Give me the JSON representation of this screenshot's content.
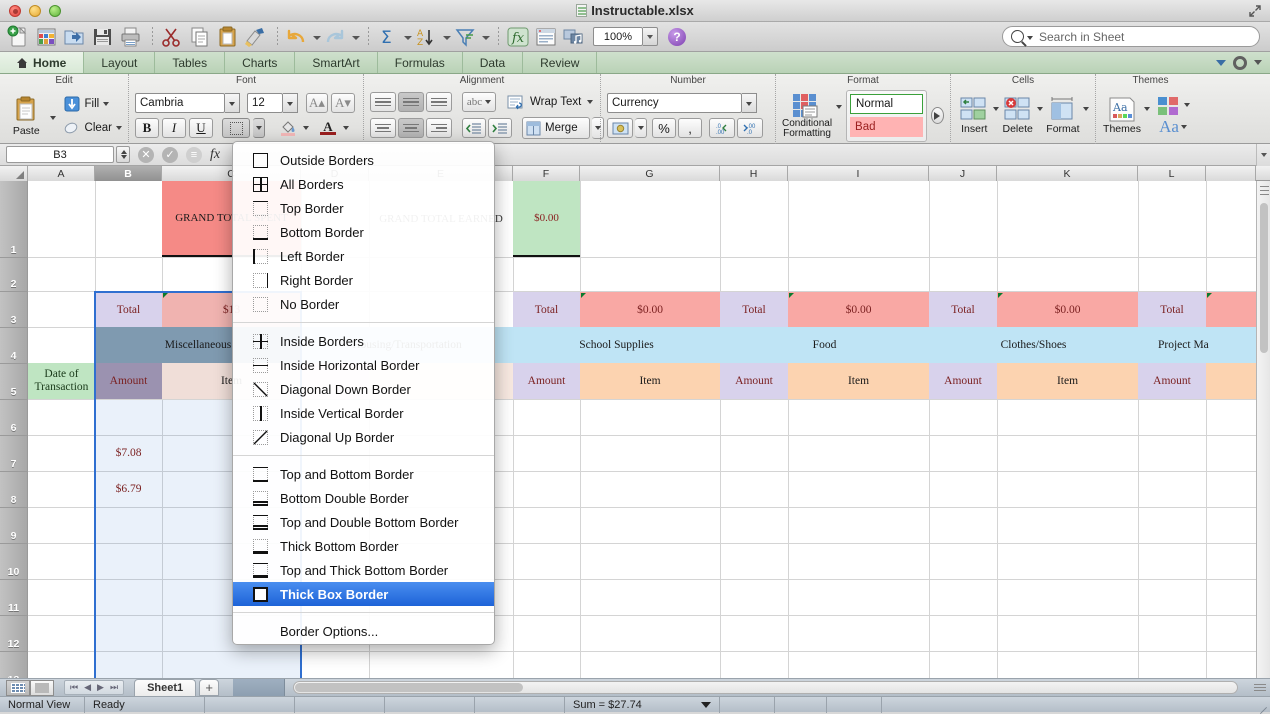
{
  "window": {
    "title": "Instructable.xlsx",
    "traffic_lights": [
      "close",
      "minimize",
      "zoom"
    ]
  },
  "toolbar": {
    "icons": [
      "new-document-icon",
      "open-template-icon",
      "open-folder-icon",
      "save-icon",
      "print-icon",
      "cut-icon",
      "copy-icon",
      "paste-icon",
      "format-painter-icon",
      "undo-icon",
      "redo-icon",
      "autosum-icon",
      "sort-icon",
      "filter-icon",
      "formula-builder-icon",
      "toolbox-icon",
      "media-browser-icon"
    ],
    "zoom_value": "100%",
    "help_label": "?"
  },
  "search": {
    "placeholder": "Search in Sheet",
    "value": ""
  },
  "tabs": {
    "items": [
      "Home",
      "Layout",
      "Tables",
      "Charts",
      "SmartArt",
      "Formulas",
      "Data",
      "Review"
    ],
    "active": "Home"
  },
  "ribbon": {
    "groups": [
      {
        "title": "Edit",
        "paste_label": "Paste",
        "fill_label": "Fill",
        "clear_label": "Clear"
      },
      {
        "title": "Font",
        "font_name": "Cambria",
        "font_size": "12",
        "bold": "B",
        "italic": "I",
        "underline": "U"
      },
      {
        "title": "Alignment",
        "orientation_label": "abc",
        "wrap_label": "Wrap Text",
        "merge_label": "Merge"
      },
      {
        "title": "Number",
        "format_value": "Currency",
        "percent_label": "%",
        "comma_label": ","
      },
      {
        "title": "Format",
        "conditional_label_line1": "Conditional",
        "conditional_label_line2": "Formatting",
        "style_normal": "Normal",
        "style_bad": "Bad"
      },
      {
        "title": "Cells",
        "insert_label": "Insert",
        "delete_label": "Delete",
        "format_label": "Format"
      },
      {
        "title": "Themes",
        "themes_label": "Themes",
        "aa_label": "Aa"
      }
    ]
  },
  "formula_bar": {
    "name_box": "B3",
    "formula": ""
  },
  "border_menu": {
    "items": [
      {
        "label": "Outside Borders",
        "icon": "outside-borders-icon",
        "highlighted": false
      },
      {
        "label": "All Borders",
        "icon": "all-borders-icon",
        "highlighted": false
      },
      {
        "label": "Top Border",
        "icon": "top-border-icon",
        "highlighted": false
      },
      {
        "label": "Bottom Border",
        "icon": "bottom-border-icon",
        "highlighted": false
      },
      {
        "label": "Left Border",
        "icon": "left-border-icon",
        "highlighted": false
      },
      {
        "label": "Right Border",
        "icon": "right-border-icon",
        "highlighted": false
      },
      {
        "label": "No Border",
        "icon": "no-border-icon",
        "highlighted": false
      },
      {
        "separator": true
      },
      {
        "label": "Inside Borders",
        "icon": "inside-borders-icon",
        "highlighted": false
      },
      {
        "label": "Inside Horizontal Border",
        "icon": "inside-horizontal-border-icon",
        "highlighted": false
      },
      {
        "label": "Diagonal Down Border",
        "icon": "diagonal-down-border-icon",
        "highlighted": false
      },
      {
        "label": "Inside Vertical Border",
        "icon": "inside-vertical-border-icon",
        "highlighted": false
      },
      {
        "label": "Diagonal Up Border",
        "icon": "diagonal-up-border-icon",
        "highlighted": false
      },
      {
        "separator": true
      },
      {
        "label": "Top and Bottom Border",
        "icon": "top-and-bottom-border-icon",
        "highlighted": false
      },
      {
        "label": "Bottom Double Border",
        "icon": "bottom-double-border-icon",
        "highlighted": false
      },
      {
        "label": "Top and Double Bottom Border",
        "icon": "top-and-double-bottom-border-icon",
        "highlighted": false
      },
      {
        "label": "Thick Bottom Border",
        "icon": "thick-bottom-border-icon",
        "highlighted": false
      },
      {
        "label": "Top and Thick Bottom Border",
        "icon": "top-and-thick-bottom-border-icon",
        "highlighted": false
      },
      {
        "label": "Thick Box Border",
        "icon": "thick-box-border-icon",
        "highlighted": true
      },
      {
        "separator": true
      },
      {
        "label": "Border Options...",
        "icon": "",
        "highlighted": false
      }
    ]
  },
  "sheet": {
    "columns": [
      "A",
      "B",
      "C",
      "D",
      "E",
      "F",
      "G",
      "H",
      "I",
      "J",
      "K",
      "L"
    ],
    "selected_column": "B",
    "rows": [
      "1",
      "2",
      "3",
      "4",
      "5",
      "6",
      "7",
      "8",
      "9",
      "10",
      "11",
      "12",
      "13"
    ],
    "cells": [
      {
        "ref": "C1",
        "text": "GRAND TOTAL SPENT",
        "fill": "#f58a86"
      },
      {
        "ref": "E1",
        "text": "GRAND TOTAL EARNED",
        "fill": "#ffffff"
      },
      {
        "ref": "F1",
        "text": "$0.00",
        "fill": "#bfe5c2"
      },
      {
        "ref": "B3",
        "text": "Total",
        "fill": "#d8d2ec"
      },
      {
        "ref": "C3",
        "text": "$13",
        "fill": "#f5a9a5"
      },
      {
        "ref": "F3",
        "text": "Total",
        "fill": "#d8d2ec"
      },
      {
        "ref": "G3",
        "text": "$0.00",
        "fill": "#f9a8a4"
      },
      {
        "ref": "H3",
        "text": "Total",
        "fill": "#d8d2ec"
      },
      {
        "ref": "I3",
        "text": "$0.00",
        "fill": "#f9a8a4"
      },
      {
        "ref": "J3",
        "text": "Total",
        "fill": "#d8d2ec"
      },
      {
        "ref": "K3",
        "text": "$0.00",
        "fill": "#f9a8a4"
      },
      {
        "ref": "L3",
        "text": "Total",
        "fill": "#d8d2ec"
      },
      {
        "ref": "B4",
        "text": "Miscellaneous",
        "fill": "#7f9ab0"
      },
      {
        "ref": "D4",
        "text": "Housing/Transportation",
        "fill": "#bfe4f5"
      },
      {
        "ref": "G4",
        "text": "School Supplies",
        "fill": "#bfe4f5"
      },
      {
        "ref": "I4",
        "text": "Food",
        "fill": "#bfe4f5"
      },
      {
        "ref": "K4",
        "text": "Clothes/Shoes",
        "fill": "#bfe4f5"
      },
      {
        "ref": "L4",
        "text": "Project Ma",
        "fill": "#bfe4f5"
      },
      {
        "ref": "A5",
        "text": "Date of Transaction",
        "fill": "#bfe5c2"
      },
      {
        "ref": "B5",
        "text": "Amount",
        "fill": "#9b92b0"
      },
      {
        "ref": "C5",
        "text": "Item",
        "fill": "#f0ded8"
      },
      {
        "ref": "F5",
        "text": "Amount",
        "fill": "#d8d2ec"
      },
      {
        "ref": "G5",
        "text": "Item",
        "fill": "#fcd3b0"
      },
      {
        "ref": "H5",
        "text": "Amount",
        "fill": "#d8d2ec"
      },
      {
        "ref": "I5",
        "text": "Item",
        "fill": "#fcd3b0"
      },
      {
        "ref": "J5",
        "text": "Amount",
        "fill": "#d8d2ec"
      },
      {
        "ref": "K5",
        "text": "Item",
        "fill": "#fcd3b0"
      },
      {
        "ref": "L5",
        "text": "Amount",
        "fill": "#d8d2ec"
      },
      {
        "ref": "B7",
        "text": "$7.08",
        "fill": ""
      },
      {
        "ref": "B8",
        "text": "$6.79",
        "fill": ""
      }
    ]
  },
  "bottom": {
    "sheet_tab": "Sheet1",
    "add_sheet": "+",
    "view_label": "Normal View",
    "status_label": "Ready",
    "sum_label": "Sum = $27.74"
  },
  "colors": {
    "accent_blue": "#1d63d8",
    "selection_border": "#2f6fd0",
    "grand_total_spent_fill": "#f58a86",
    "grand_total_earned_fill": "#bfe5c2",
    "header_blue_fill": "#bfe4f5",
    "total_purple_fill": "#d8d2ec"
  }
}
